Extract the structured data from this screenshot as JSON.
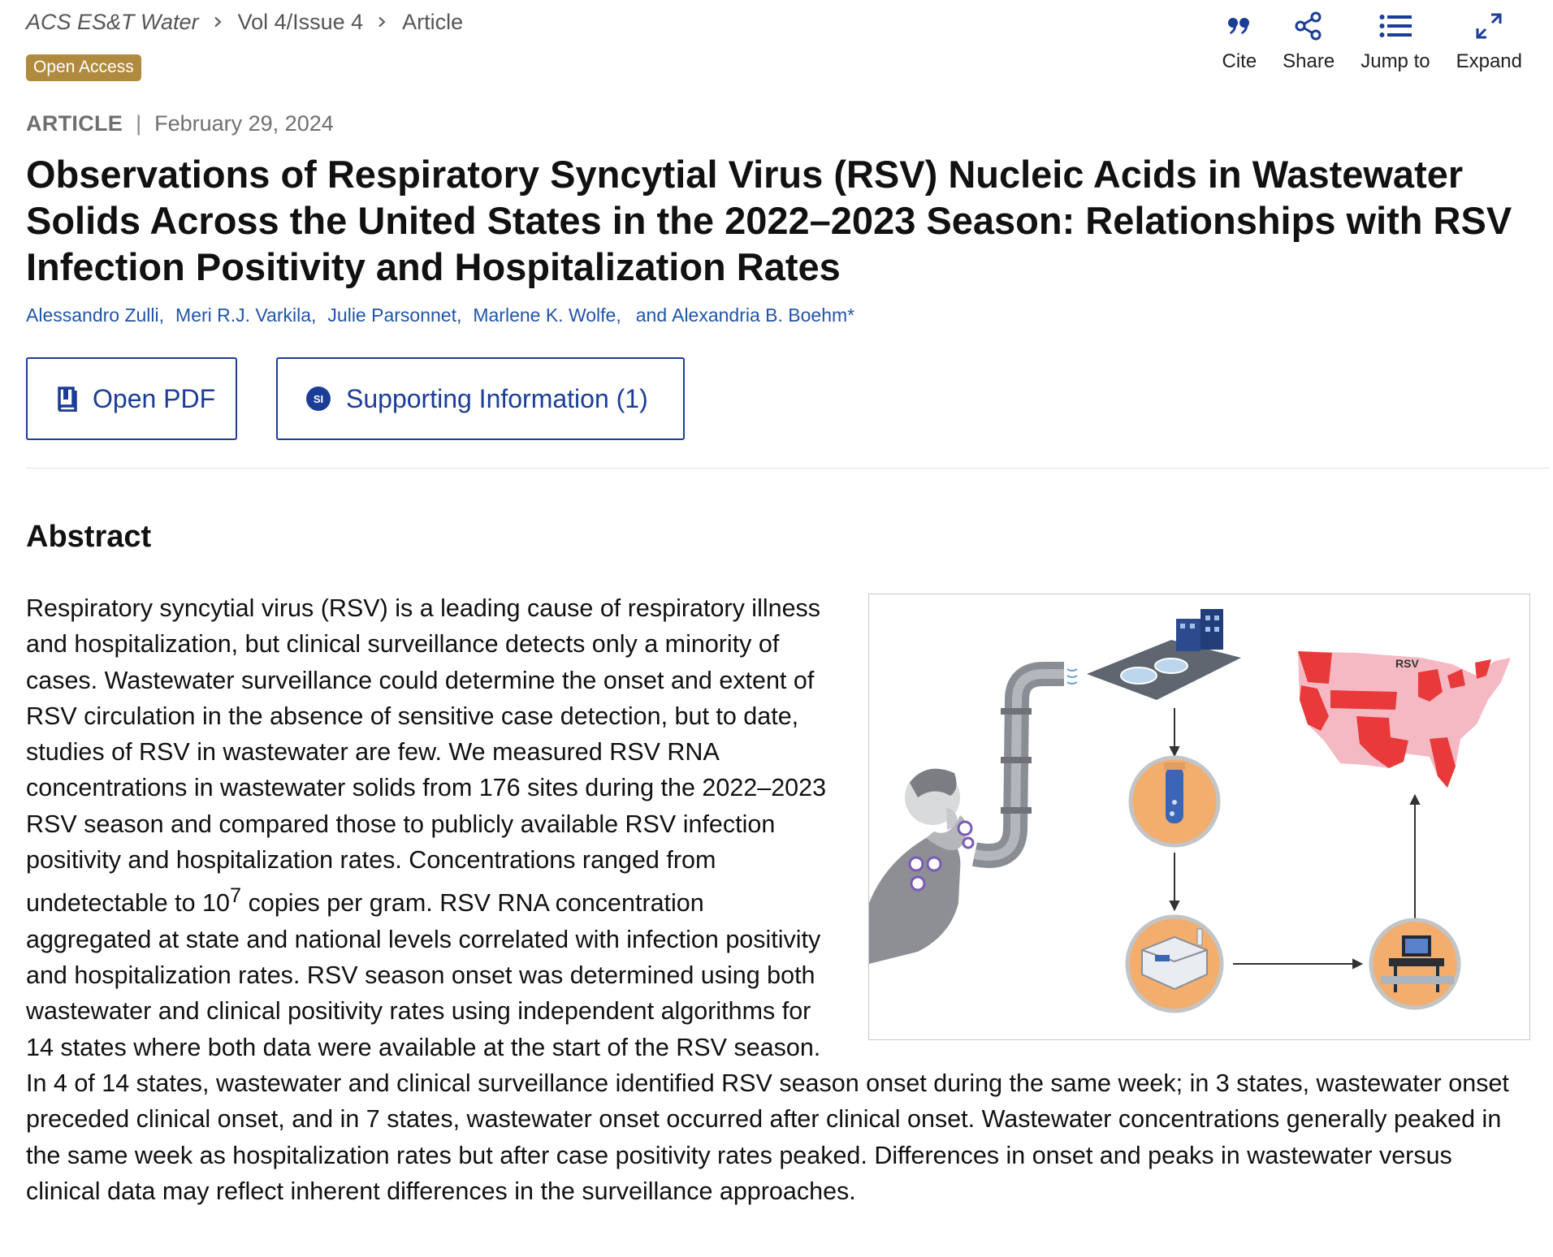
{
  "breadcrumb": {
    "journal": "ACS ES&T Water",
    "issue": "Vol 4/Issue 4",
    "current": "Article"
  },
  "badge": "Open Access",
  "tools": {
    "cite": "Cite",
    "share": "Share",
    "jump": "Jump to",
    "expand": "Expand"
  },
  "meta": {
    "type": "ARTICLE",
    "separator": "|",
    "date": "February 29, 2024"
  },
  "title": "Observations of Respiratory Syncytial Virus (RSV) Nucleic Acids in Wastewater Solids Across the United States in the 2022–2023 Season: Relationships with RSV Infection Positivity and Hospitalization Rates",
  "authors": [
    "Alessandro Zulli",
    "Meri R.J. Varkila",
    "Julie Parsonnet",
    "Marlene K. Wolfe",
    "Alexandria B. Boehm*"
  ],
  "authors_and": "and",
  "buttons": {
    "pdf": "Open PDF",
    "si": "Supporting Information (1)",
    "si_icon_text": "SI"
  },
  "abstract": {
    "heading": "Abstract",
    "text_before_sup": "Respiratory syncytial virus (RSV) is a leading cause of respiratory illness and hospitalization, but clinical surveillance detects only a minority of cases. Wastewater surveillance could determine the onset and extent of RSV circulation in the absence of sensitive case detection, but to date, studies of RSV in wastewater are few. We measured RSV RNA concentrations in wastewater solids from 176 sites during the 2022–2023 RSV season and compared those to publicly available RSV infection positivity and hospitalization rates. Concentrations ranged from undetectable to 10",
    "sup": "7",
    "text_after_sup": " copies per gram. RSV RNA concentration aggregated at state and national levels correlated with infection positivity and hospitalization rates. RSV season onset was determined using both wastewater and clinical positivity rates using independent algorithms for 14 states where both data were available at the start of the RSV season. In 4 of 14 states, wastewater and clinical surveillance identified RSV season onset during the same week; in 3 states, wastewater onset preceded clinical onset, and in 7 states, wastewater onset occurred after clinical onset. Wastewater concentrations generally peaked in the same week as hospitalization rates but after case positivity rates peaked. Differences in onset and peaks in wastewater versus clinical data may reflect inherent differences in the surveillance approaches.",
    "toc_map_label": "RSV"
  },
  "colors": {
    "link": "#2155a8",
    "button": "#1b3d96",
    "badge": "#b08a3e"
  }
}
